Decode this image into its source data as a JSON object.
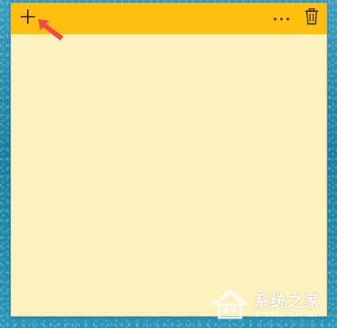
{
  "note": {
    "body_text": "",
    "colors": {
      "titlebar": "#fdbe0f",
      "body": "#fdf2bd",
      "arrow": "#f2474a"
    }
  },
  "toolbar": {
    "add_icon": "plus-icon",
    "more_icon": "ellipsis-icon",
    "delete_icon": "trash-icon"
  },
  "watermark": {
    "title": "系统之家",
    "url": "XITONGZHIJIA.NET"
  }
}
